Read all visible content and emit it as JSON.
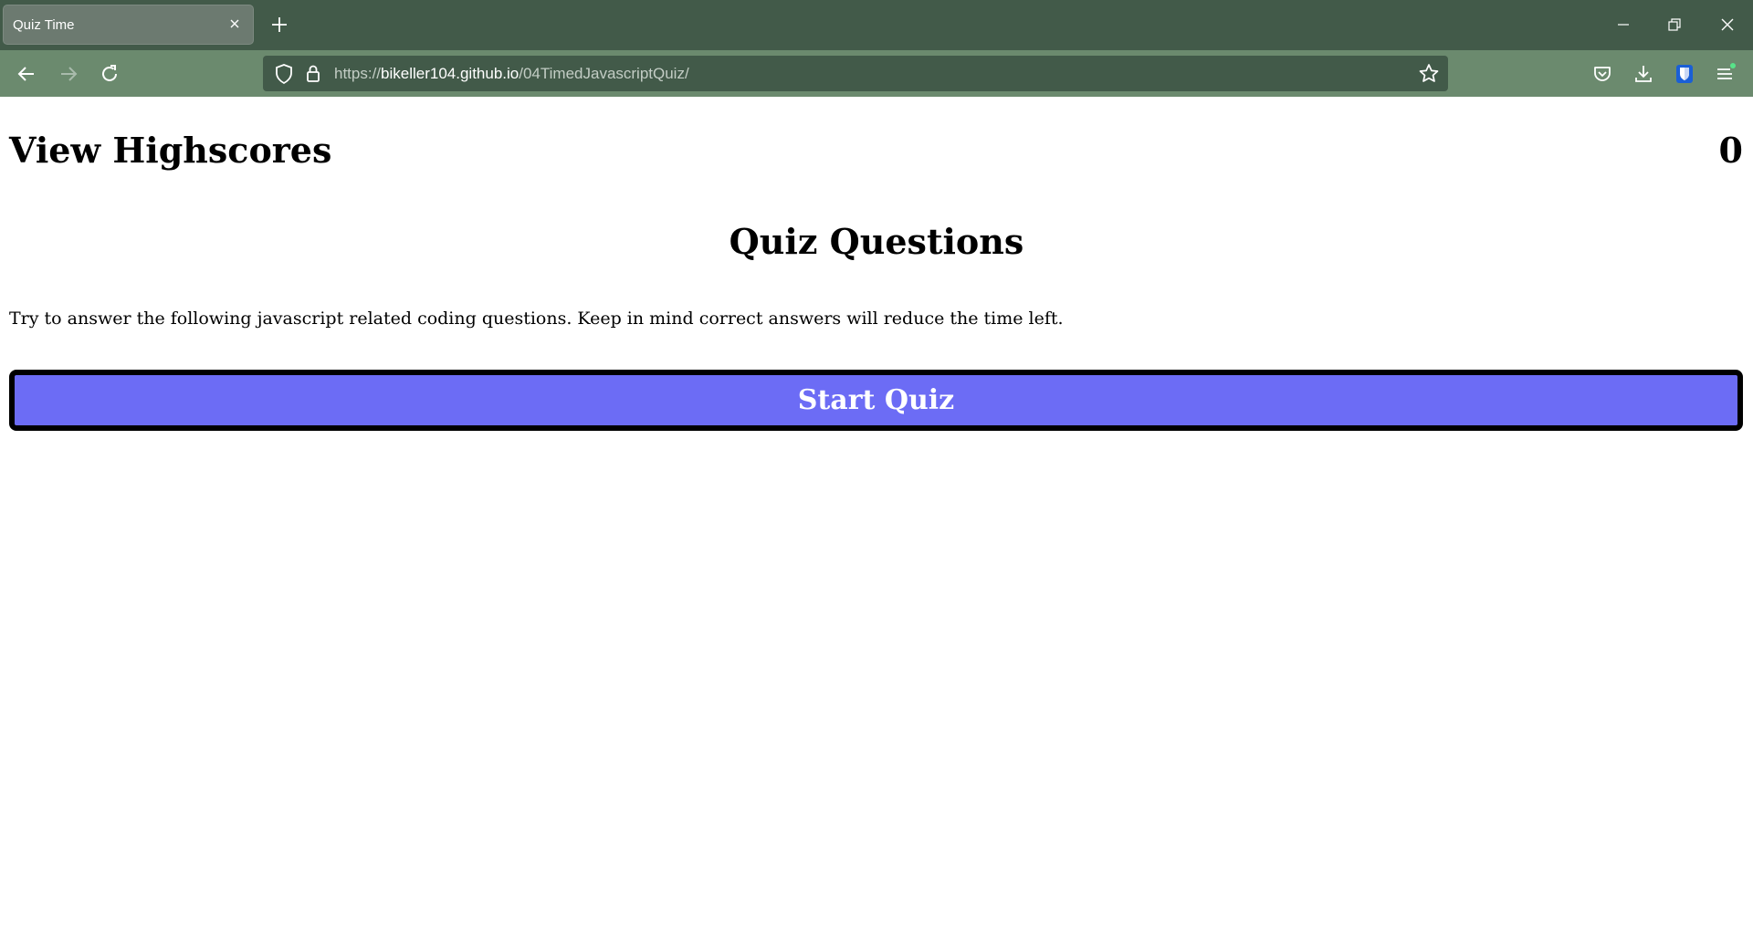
{
  "browser": {
    "tab_title": "Quiz Time",
    "url_scheme": "https://",
    "url_host": "bikeller104.github.io",
    "url_path": "/04TimedJavascriptQuiz/",
    "icons": [
      "back-arrow-icon",
      "forward-arrow-icon",
      "reload-icon",
      "shield-icon",
      "lock-icon",
      "star-icon",
      "pocket-icon",
      "download-icon",
      "bitwarden-icon",
      "menu-icon",
      "minimize-icon",
      "restore-icon",
      "close-icon",
      "new-tab-icon"
    ],
    "colors": {
      "tabbar": "#425a49",
      "navbar": "#6b8a6e",
      "urlbar": "#425a49"
    }
  },
  "page": {
    "highscores_label": "View Highscores",
    "timer_value": "0",
    "title": "Quiz Questions",
    "intro": "Try to answer the following javascript related coding questions. Keep in mind correct answers will reduce the time left.",
    "start_label": "Start Quiz",
    "colors": {
      "start_button": "#6c6cf5",
      "start_button_border": "#000000"
    }
  }
}
